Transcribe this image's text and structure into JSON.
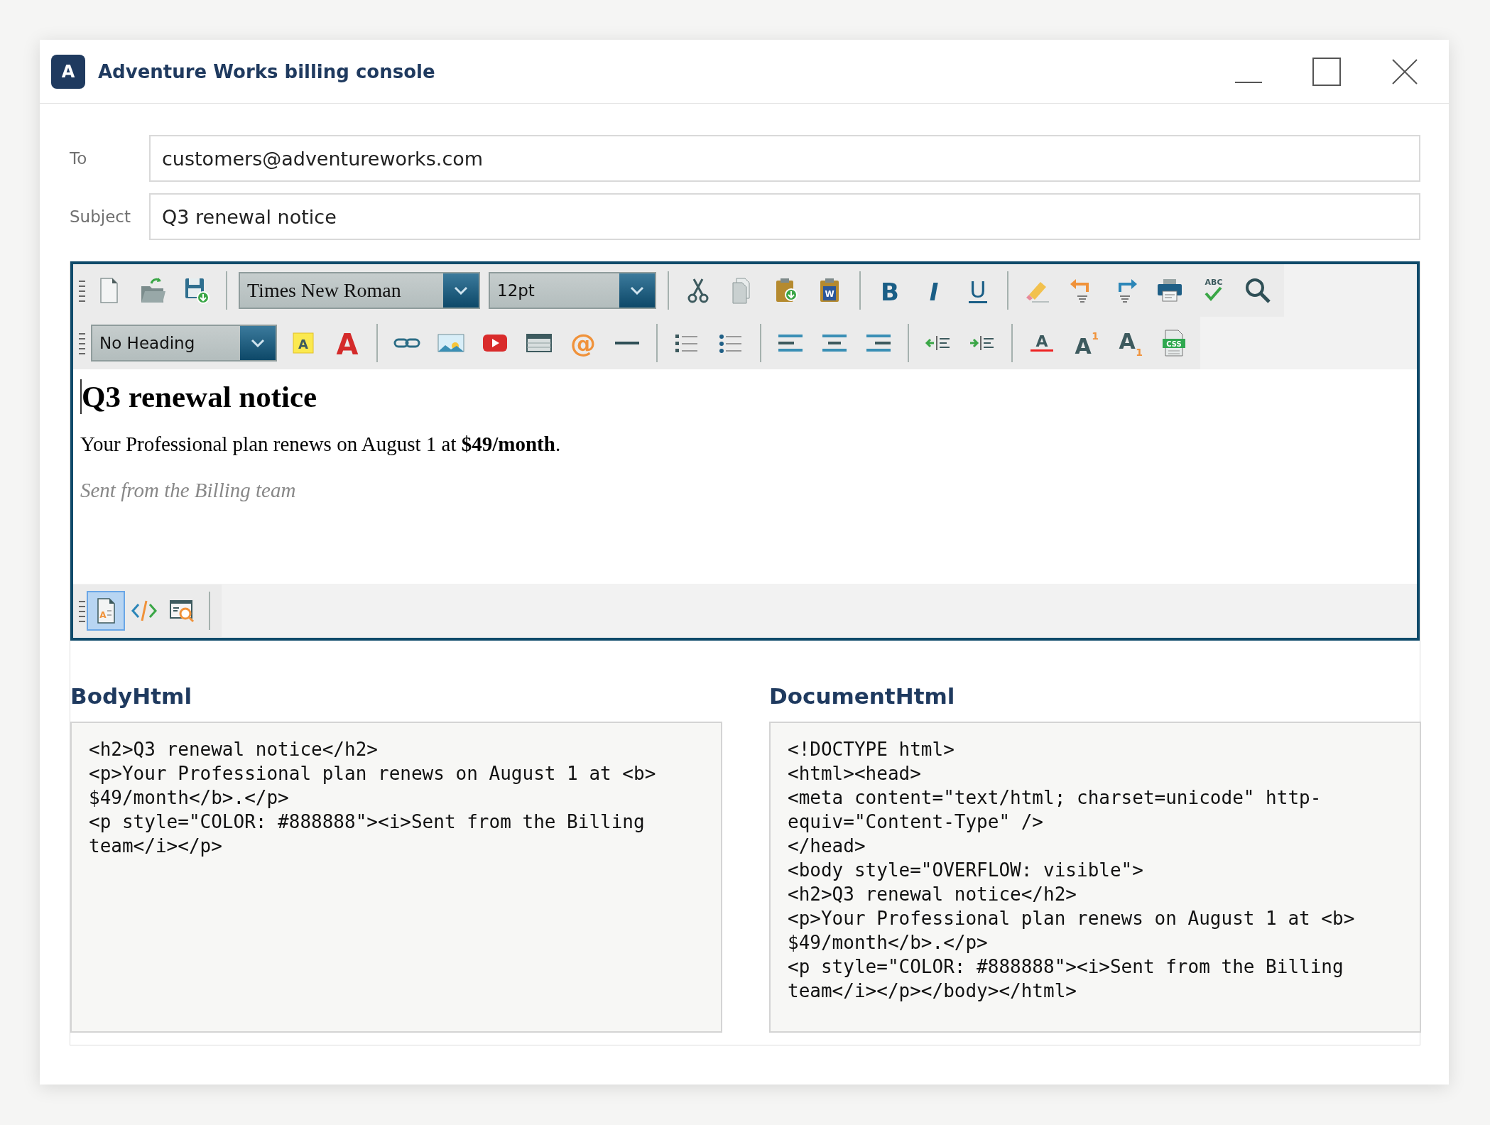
{
  "window": {
    "logo": "A",
    "title": "Adventure Works billing console"
  },
  "fields": [
    {
      "label": "To",
      "value": "customers@adventureworks.com"
    },
    {
      "label": "Subject",
      "value": "Q3 renewal notice"
    }
  ],
  "editor": {
    "toolbar_rows": [
      [
        {
          "kind": "grip"
        },
        {
          "kind": "new"
        },
        {
          "kind": "open"
        },
        {
          "kind": "save"
        },
        {
          "kind": "separator"
        },
        {
          "kind": "font-dropdown",
          "value": "Times New Roman"
        },
        {
          "kind": "size-dropdown",
          "value": "12pt"
        },
        {
          "kind": "separator"
        },
        {
          "kind": "cut"
        },
        {
          "kind": "copy"
        },
        {
          "kind": "paste"
        },
        {
          "kind": "paste-word",
          "glyph": "W"
        },
        {
          "kind": "separator"
        },
        {
          "kind": "bold",
          "glyph": "B"
        },
        {
          "kind": "italic",
          "glyph": "I"
        },
        {
          "kind": "underline",
          "glyph": "U"
        },
        {
          "kind": "separator"
        },
        {
          "kind": "eraser"
        },
        {
          "kind": "undo"
        },
        {
          "kind": "redo"
        },
        {
          "kind": "print"
        },
        {
          "kind": "spellcheck",
          "glyph": "ABC"
        },
        {
          "kind": "search"
        }
      ],
      [
        {
          "kind": "grip"
        },
        {
          "kind": "heading-dropdown",
          "value": "No Heading"
        },
        {
          "kind": "highlight",
          "glyph": "A"
        },
        {
          "kind": "font-color",
          "glyph": "A"
        },
        {
          "kind": "separator"
        },
        {
          "kind": "link"
        },
        {
          "kind": "image"
        },
        {
          "kind": "video"
        },
        {
          "kind": "table"
        },
        {
          "kind": "email",
          "glyph": "@"
        },
        {
          "kind": "rule"
        },
        {
          "kind": "separator"
        },
        {
          "kind": "numbered-list"
        },
        {
          "kind": "bulleted-list"
        },
        {
          "kind": "separator"
        },
        {
          "kind": "align-left"
        },
        {
          "kind": "align-center"
        },
        {
          "kind": "align-right"
        },
        {
          "kind": "separator"
        },
        {
          "kind": "outdent"
        },
        {
          "kind": "indent"
        },
        {
          "kind": "separator"
        },
        {
          "kind": "strikethrough",
          "glyph": "A"
        },
        {
          "kind": "superscript",
          "glyph": "A",
          "index": "1"
        },
        {
          "kind": "subscript",
          "glyph": "A",
          "index": "1"
        },
        {
          "kind": "css",
          "glyph": "CSS"
        }
      ]
    ],
    "content": {
      "heading": "Q3 renewal notice",
      "paragraph": "Your Professional plan renews on August 1 at **$49/month**.",
      "signature": "Sent from the Billing team"
    },
    "view_modes": [
      {
        "kind": "design",
        "glyph": "A",
        "selected": true
      },
      {
        "kind": "source",
        "selected": false
      },
      {
        "kind": "preview",
        "selected": false
      }
    ]
  },
  "panels": [
    {
      "title": "BodyHtml",
      "lines": [
        "<h2>Q3 renewal notice</h2>",
        "<p>Your Professional plan renews on August 1 at <b>",
        "$49/month</b>.</p>",
        "<p style=\"COLOR: #888888\"><i>Sent from the Billing",
        "team</i></p>"
      ]
    },
    {
      "title": "DocumentHtml",
      "lines": [
        "<!DOCTYPE html>",
        "<html><head>",
        "<meta content=\"text/html; charset=unicode\" http-",
        "equiv=\"Content-Type\" />",
        "</head>",
        "<body style=\"OVERFLOW: visible\">",
        "<h2>Q3 renewal notice</h2>",
        "<p>Your Professional plan renews on August 1 at <b>",
        "$49/month</b>.</p>",
        "<p style=\"COLOR: #888888\"><i>Sent from the Billing",
        "team</i></p></body></html>"
      ]
    }
  ]
}
